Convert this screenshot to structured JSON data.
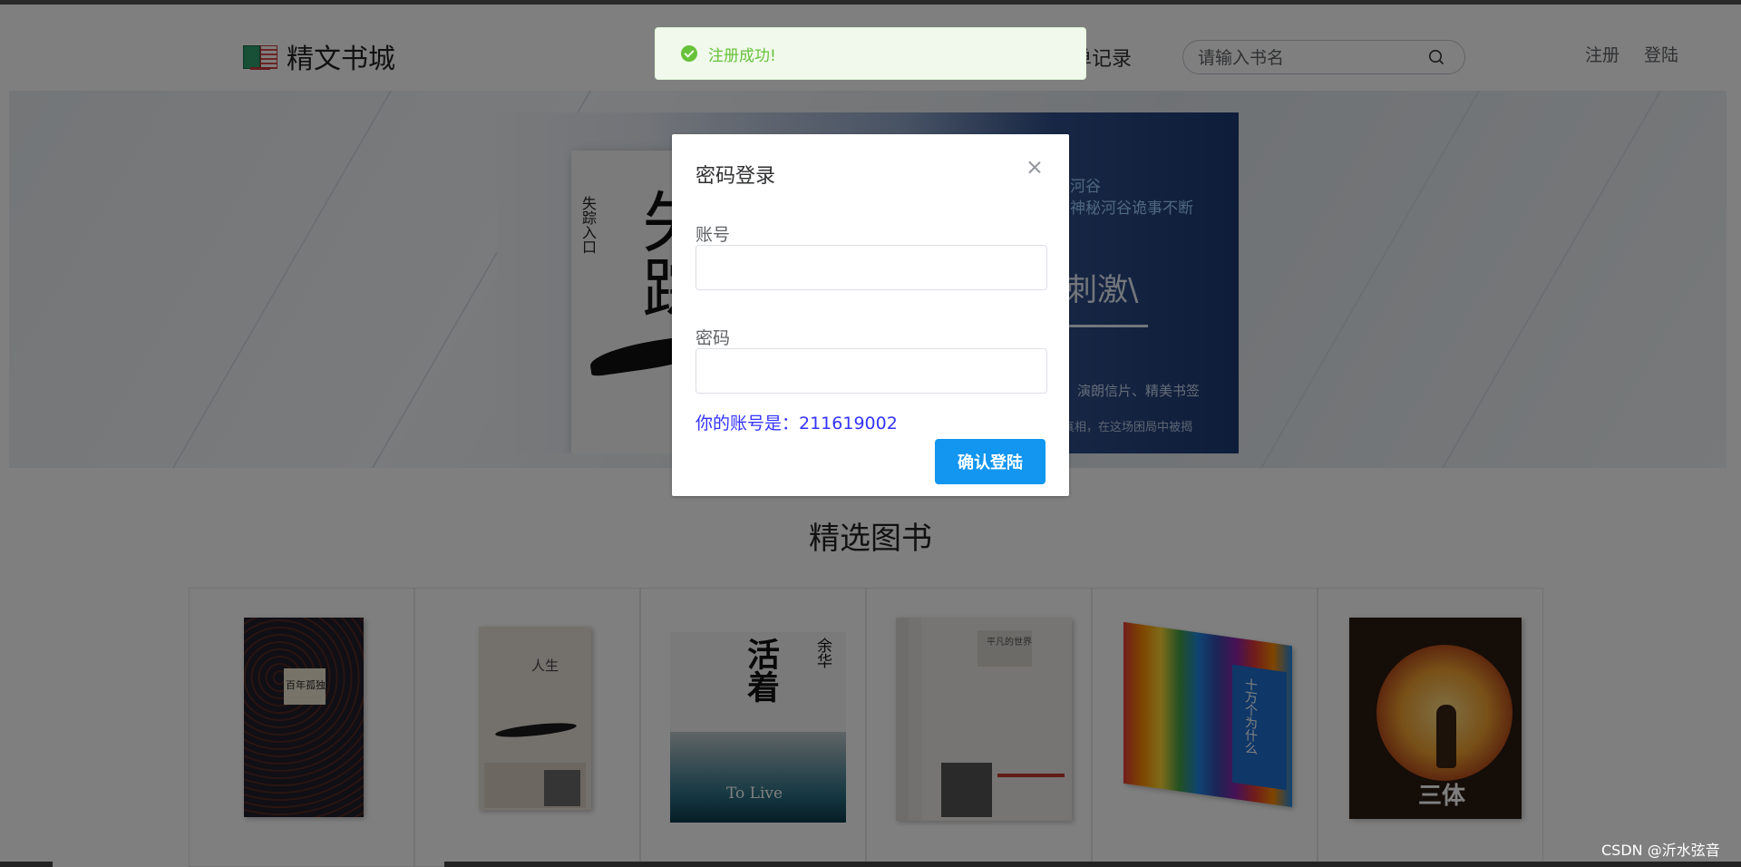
{
  "header": {
    "logo_text": "精文书城",
    "nav_partial": "单记录",
    "search_placeholder": "请输入书名",
    "register": "注册",
    "login": "登陆"
  },
  "banner": {
    "book_title": "失踪",
    "book_side": "失踪入口",
    "ad_line1": "河谷",
    "ad_line2": "神秘河谷诡事不断",
    "ad_big": "刺激\\",
    "ad_line3": "演朗信片、精美书签",
    "ad_line4": "真相，在这场困局中被揭"
  },
  "section": {
    "title": "精选图书"
  },
  "books": [
    {
      "cover_text": "百年孤独",
      "colors": {
        "bg": "#1e1e2a",
        "accent": "#8c3a2a"
      }
    },
    {
      "cover_text": "人生",
      "colors": {
        "bg": "#e9e3da",
        "accent": "#1a1a1a"
      }
    },
    {
      "cover_text": "活着",
      "author": "余华",
      "en": "To Live",
      "colors": {
        "bg": "#f4f4f4",
        "accent": "#2b6f86"
      }
    },
    {
      "cover_text": "平凡的世界",
      "colors": {
        "bg": "#ecebe8",
        "accent": "#c0392b"
      }
    },
    {
      "cover_text": "十万个为什么",
      "colors": {
        "bg": "#f0f0f0",
        "accent": "#1f6fd0"
      }
    },
    {
      "cover_text": "三体",
      "colors": {
        "bg": "#2a1a10",
        "accent": "#f0a030"
      }
    }
  ],
  "toast": {
    "text": "注册成功!",
    "type": "success"
  },
  "dialog": {
    "title": "密码登录",
    "account_label": "账号",
    "account_value": "",
    "password_label": "密码",
    "password_value": "",
    "hint": "你的账号是：211619002",
    "confirm_label": "确认登陆"
  },
  "watermark": "CSDN @沂水弦音",
  "colors": {
    "primary": "#1296f0",
    "success": "#67c23a",
    "hint": "#3333ff"
  }
}
